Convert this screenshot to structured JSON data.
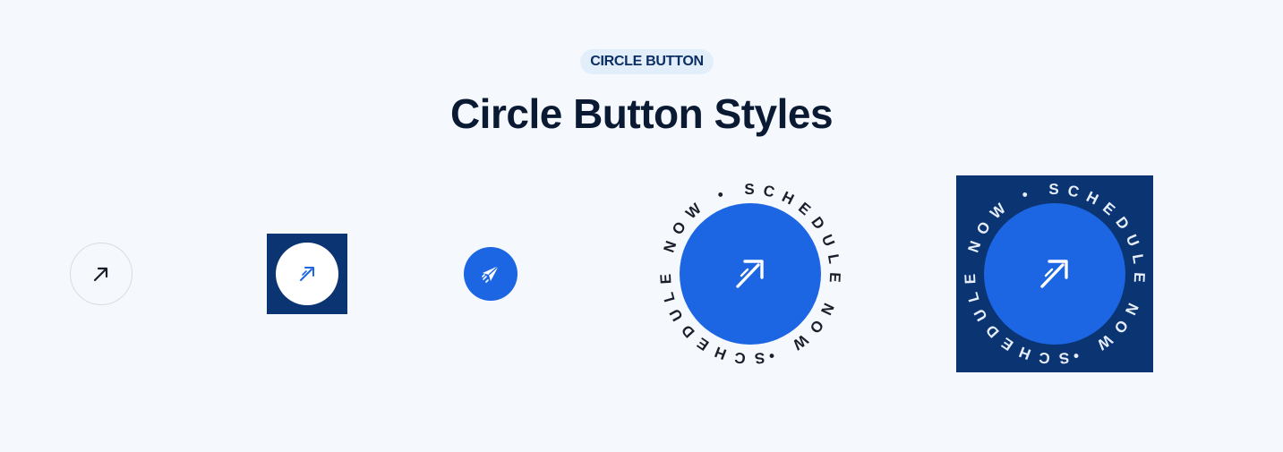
{
  "header": {
    "badge_label": "CIRCLE BUTTON",
    "title": "Circle Button Styles"
  },
  "buttons": [
    {
      "style": "outline",
      "icon": "arrow-up-right-icon",
      "icon_color": "#1a1f2b",
      "background": "transparent",
      "border_color": "#d9dde3"
    },
    {
      "style": "white-on-navy",
      "icon": "arrow-up-right-icon",
      "icon_color": "#1c66e3",
      "background": "#ffffff",
      "frame_color": "#0a3472"
    },
    {
      "style": "solid-blue",
      "icon": "paper-plane-icon",
      "icon_color": "#ffffff",
      "background": "#1c66e3"
    },
    {
      "style": "rotating-text",
      "icon": "arrow-up-right-icon",
      "background": "#1c66e3",
      "ring_text": "SCHEDULE NOW • SCHEDULE NOW •",
      "ring_text_color": "#1a1f2b"
    },
    {
      "style": "rotating-text-on-navy",
      "icon": "arrow-up-right-icon",
      "background": "#1c66e3",
      "frame_color": "#0a3472",
      "ring_text": "SCHEDULE NOW • SCHEDULE NOW •",
      "ring_text_color": "#e6eefb"
    }
  ],
  "colors": {
    "page_background": "#f5f9fe",
    "primary_blue": "#1c66e3",
    "navy": "#0a3472",
    "title_text": "#0b1a33"
  }
}
